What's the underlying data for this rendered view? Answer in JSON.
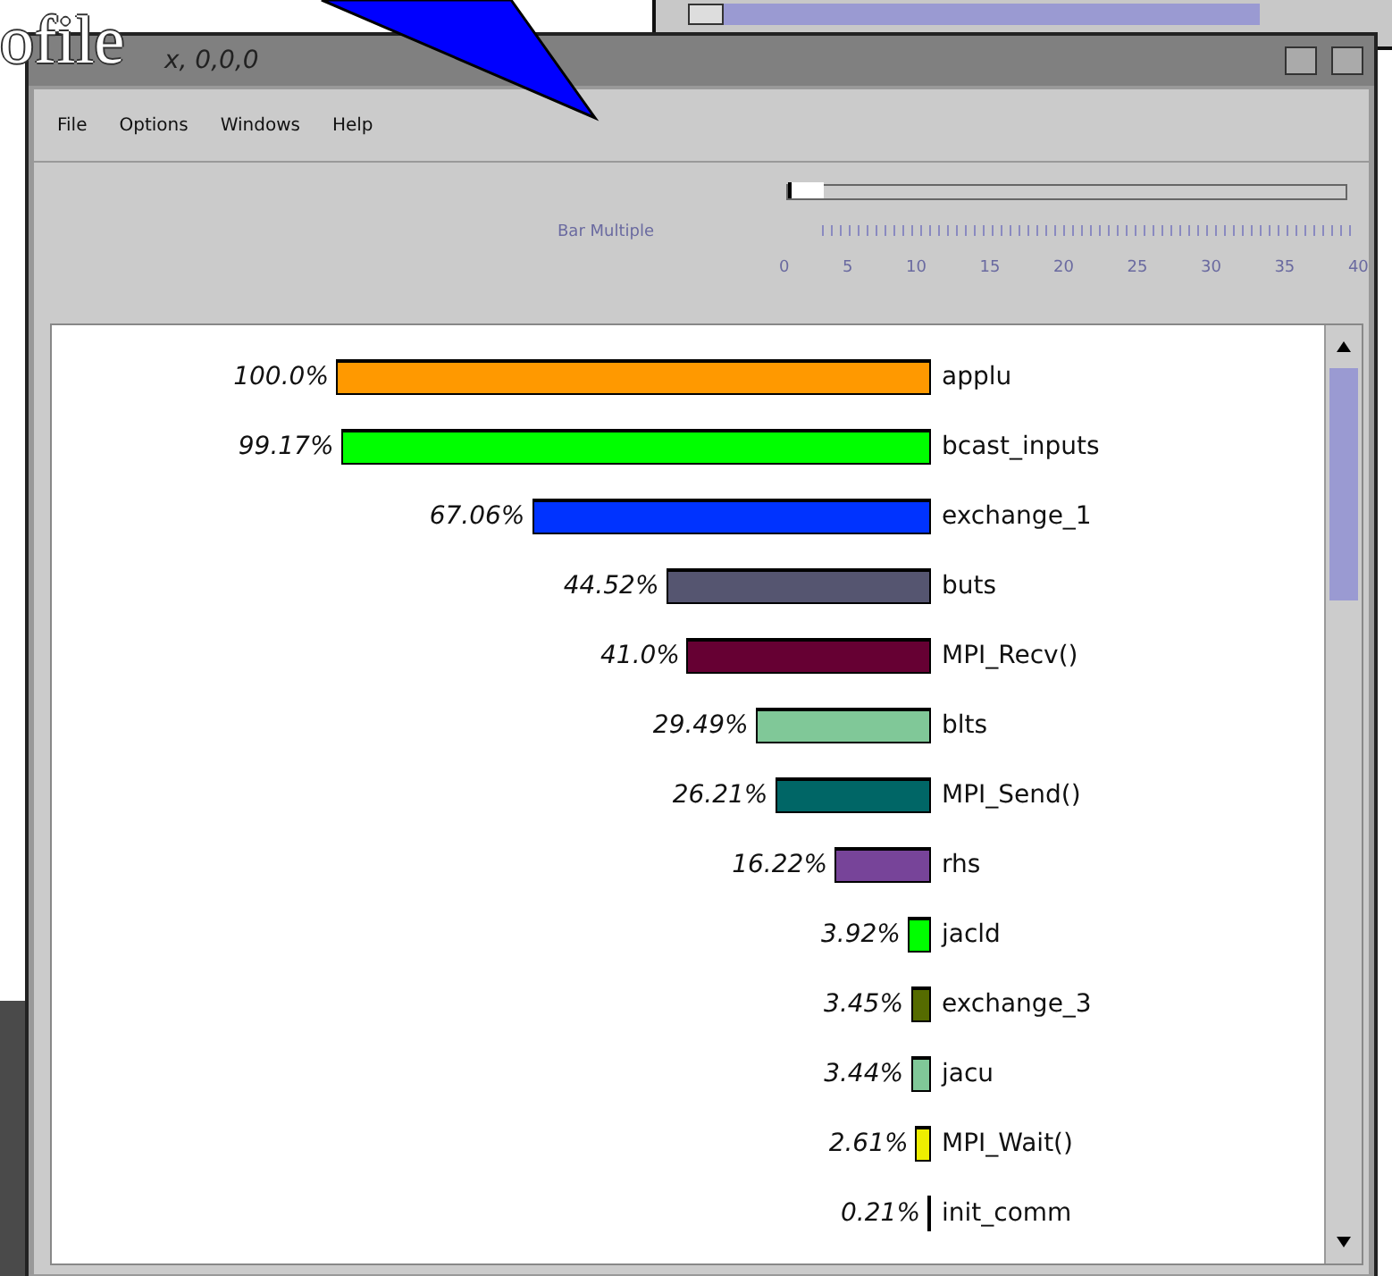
{
  "slide_title": "ofile",
  "window": {
    "title": "x, 0,0,0"
  },
  "menu": [
    "File",
    "Options",
    "Windows",
    "Help"
  ],
  "scale": {
    "label": "Bar Multiple",
    "level": 0.0,
    "ticks": [
      "0",
      "5",
      "10",
      "15",
      "20",
      "25",
      "30",
      "35",
      "40"
    ]
  },
  "rows": [
    {
      "percent": "100.0%",
      "name": "applu",
      "color": "#ff9900"
    },
    {
      "percent": "99.17%",
      "name": "bcast_inputs",
      "color": "#00ff00"
    },
    {
      "percent": "67.06%",
      "name": "exchange_1",
      "color": "#0033ff"
    },
    {
      "percent": "44.52%",
      "name": "buts",
      "color": "#555570"
    },
    {
      "percent": "41.0%",
      "name": "MPI_Recv()",
      "color": "#660033"
    },
    {
      "percent": "29.49%",
      "name": "blts",
      "color": "#80c898"
    },
    {
      "percent": "26.21%",
      "name": "MPI_Send()",
      "color": "#006666"
    },
    {
      "percent": "16.22%",
      "name": "rhs",
      "color": "#774499"
    },
    {
      "percent": "3.92%",
      "name": "jacld",
      "color": "#00ff00"
    },
    {
      "percent": "3.45%",
      "name": "exchange_3",
      "color": "#556b00"
    },
    {
      "percent": "3.44%",
      "name": "jacu",
      "color": "#80c898"
    },
    {
      "percent": "2.61%",
      "name": "MPI_Wait()",
      "color": "#eeee00"
    },
    {
      "percent": "0.21%",
      "name": "init_comm"
    }
  ]
}
